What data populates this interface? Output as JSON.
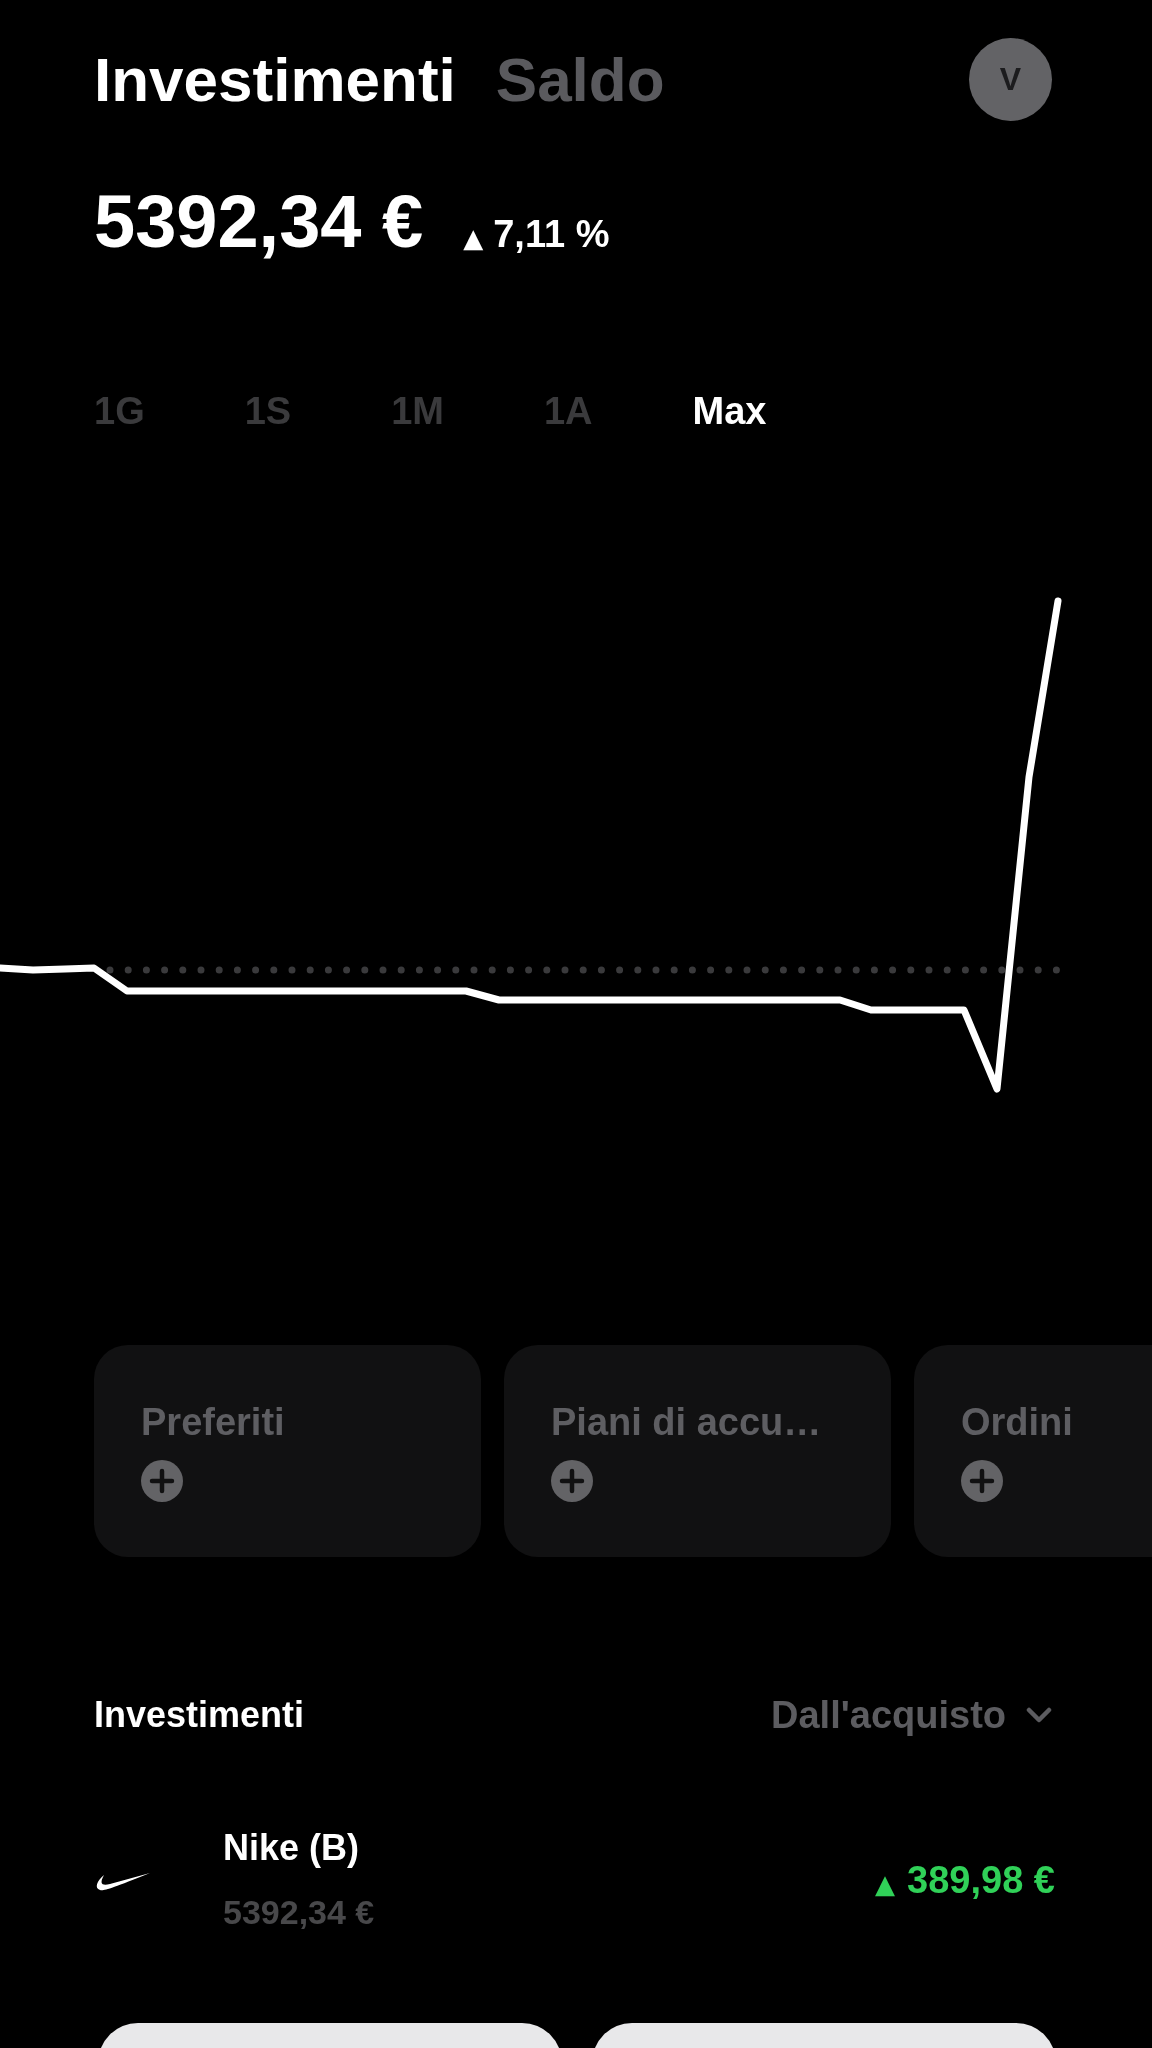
{
  "header": {
    "tabs": [
      {
        "label": "Investimenti",
        "selected": true
      },
      {
        "label": "Saldo",
        "selected": false
      }
    ],
    "avatar": "V"
  },
  "summary": {
    "total": "5392,34 €",
    "arrow": "▲",
    "change": "7,11 %"
  },
  "ranges": [
    {
      "label": "1G",
      "selected": false
    },
    {
      "label": "1S",
      "selected": false
    },
    {
      "label": "1M",
      "selected": false
    },
    {
      "label": "1A",
      "selected": false
    },
    {
      "label": "Max",
      "selected": true
    }
  ],
  "shortcuts": [
    {
      "title": "Preferiti"
    },
    {
      "title": "Piani di accu…"
    },
    {
      "title": "Ordini"
    }
  ],
  "holdings": {
    "title": "Investimenti",
    "filter": "Dall'acquisto",
    "items": [
      {
        "name": "Nike (B)",
        "value": "5392,34 €",
        "arrow": "▲",
        "gain": "389,98 €"
      }
    ]
  }
}
